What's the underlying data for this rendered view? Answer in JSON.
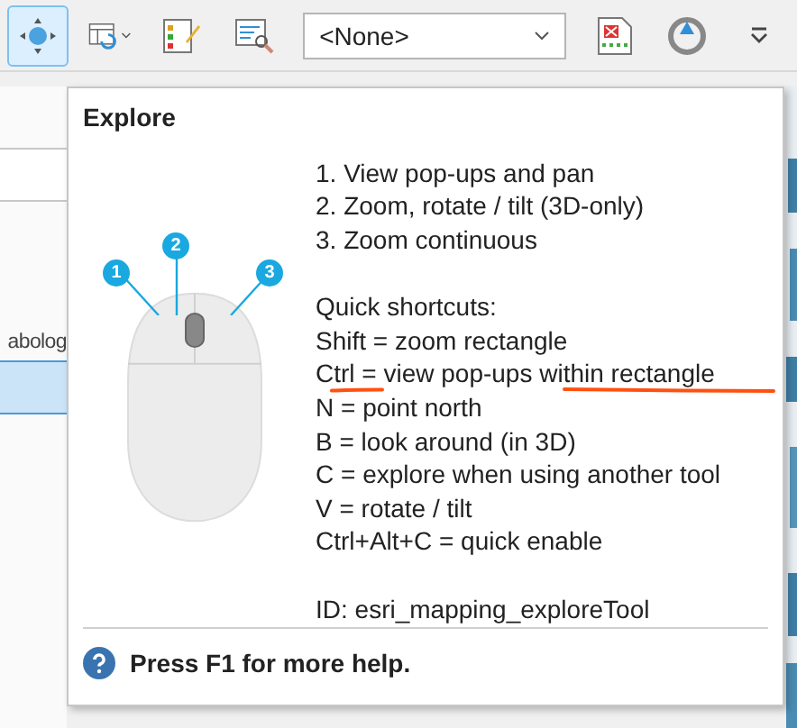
{
  "toolbar": {
    "tools": [
      {
        "kind": "explore",
        "selected": true
      },
      {
        "kind": "layout",
        "selected": false
      },
      {
        "kind": "edit",
        "selected": false
      },
      {
        "kind": "inspect",
        "selected": false
      }
    ],
    "dropdown": {
      "value": "<None>"
    }
  },
  "side_panel": {
    "row_label": "abolog",
    "selected_row": true
  },
  "tooltip": {
    "title": "Explore",
    "callouts": [
      "1",
      "2",
      "3"
    ],
    "actions": [
      "1. View pop-ups and pan",
      "2. Zoom, rotate / tilt (3D-only)",
      "3. Zoom continuous"
    ],
    "shortcuts_heading": "Quick shortcuts:",
    "shortcuts": [
      "Shift = zoom rectangle",
      "Ctrl = view pop-ups within rectangle",
      "N = point north",
      "B = look around (in 3D)",
      "C = explore when using another tool",
      "V = rotate / tilt",
      "Ctrl+Alt+C = quick enable"
    ],
    "id": "ID: esri_mapping_exploreTool",
    "footer": "Press F1 for more help."
  }
}
